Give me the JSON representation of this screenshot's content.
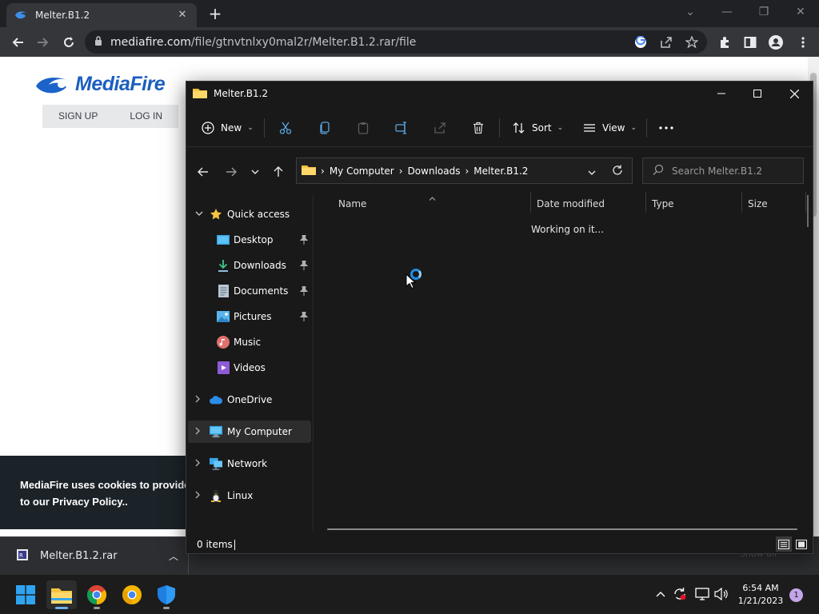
{
  "browser": {
    "tab_title": "Melter.B1.2",
    "url_domain": "mediafire.com",
    "url_path": "/file/gtnvtnlxy0mal2r/Melter.B1.2.rar/file"
  },
  "webpage": {
    "logo_text": "MediaFire",
    "nav": [
      "SIGN UP",
      "LOG IN"
    ],
    "cookie_line1": "MediaFire uses cookies to provide y",
    "cookie_line2": "to our Privacy Policy.."
  },
  "download_bar": {
    "file_name": "Melter.B1.2.rar",
    "show_all": "Show all"
  },
  "explorer": {
    "title": "Melter.B1.2",
    "commands": {
      "new": "New",
      "sort": "Sort",
      "view": "View"
    },
    "breadcrumbs": [
      "My Computer",
      "Downloads",
      "Melter.B1.2"
    ],
    "search_placeholder": "Search Melter.B1.2",
    "quick_access": "Quick access",
    "quick_items": [
      "Desktop",
      "Downloads",
      "Documents",
      "Pictures",
      "Music",
      "Videos"
    ],
    "locations": [
      "OneDrive",
      "My Computer",
      "Network",
      "Linux"
    ],
    "columns": [
      "Name",
      "Date modified",
      "Type",
      "Size"
    ],
    "status_message": "Working on it...",
    "item_count": "0 items"
  },
  "taskbar": {
    "time": "6:54 AM",
    "date": "1/21/2023",
    "notification_count": "1"
  }
}
